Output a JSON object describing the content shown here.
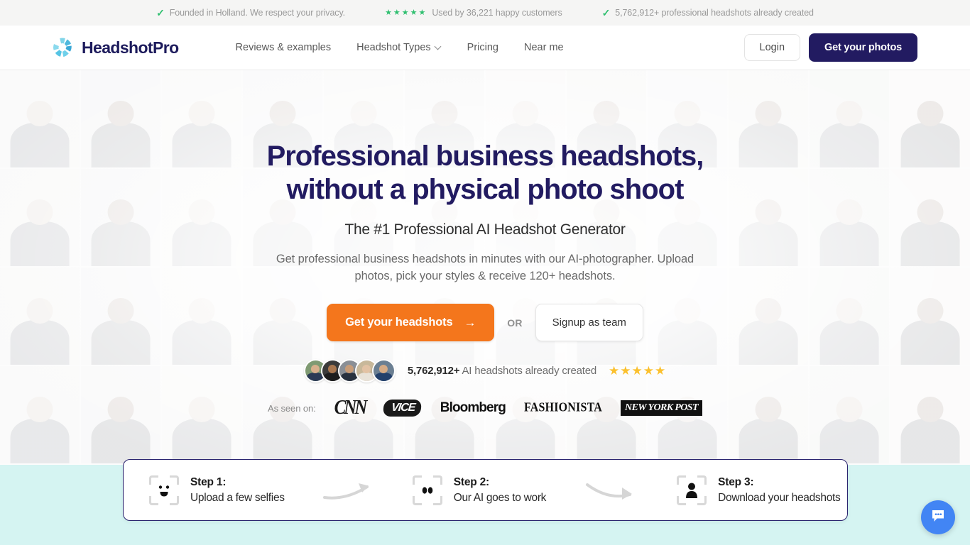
{
  "topbar": {
    "items": [
      {
        "icon": "check-icon",
        "text": "Founded in Holland. We respect your privacy."
      },
      {
        "icon": "stars-icon",
        "stars": "★★★★★",
        "text": "Used by 36,221 happy customers"
      },
      {
        "icon": "check-icon",
        "text": "5,762,912+ professional headshots already created"
      }
    ],
    "check_glyph": "✓",
    "star_color": "#2fbf6f"
  },
  "header": {
    "brand": "HeadshotPro",
    "brand_color": "#1d1b5c",
    "nav": [
      {
        "label": "Reviews & examples",
        "has_dropdown": false
      },
      {
        "label": "Headshot Types",
        "has_dropdown": true
      },
      {
        "label": "Pricing",
        "has_dropdown": false
      },
      {
        "label": "Near me",
        "has_dropdown": false
      }
    ],
    "login_label": "Login",
    "cta_label": "Get your photos",
    "cta_color": "#221b61"
  },
  "hero": {
    "title_line1": "Professional business headshots,",
    "title_line2": "without a physical photo shoot",
    "subtitle": "The #1 Professional AI Headshot Generator",
    "description": "Get professional business headshots in minutes with our AI-photographer. Upload photos, pick your styles & receive 120+ headshots.",
    "cta_label": "Get your headshots",
    "cta_arrow": "→",
    "cta_color": "#f4761c",
    "or_label": "OR",
    "secondary_cta_label": "Signup as team",
    "proof_count": "5,762,912+",
    "proof_text": " AI headshots already created",
    "proof_stars": "★★★★★",
    "proof_star_color": "#fbc02d",
    "seen_label": "As seen on:",
    "press_logos": [
      "CNN",
      "VICE",
      "Bloomberg",
      "FASHIONISTA",
      "NEW YORK POST"
    ]
  },
  "steps": [
    {
      "title": "Step 1:",
      "desc": "Upload a few selfies",
      "icon": "scan-smiley-icon"
    },
    {
      "title": "Step 2:",
      "desc": "Our AI goes to work",
      "icon": "scan-eyes-icon"
    },
    {
      "title": "Step 3:",
      "desc": "Download your headshots",
      "icon": "scan-person-icon"
    }
  ],
  "chat": {
    "icon": "chat-bubble-icon",
    "color": "#4285f4"
  },
  "colors": {
    "teal_band": "#d5f4f2",
    "card_border": "#2b2570"
  }
}
